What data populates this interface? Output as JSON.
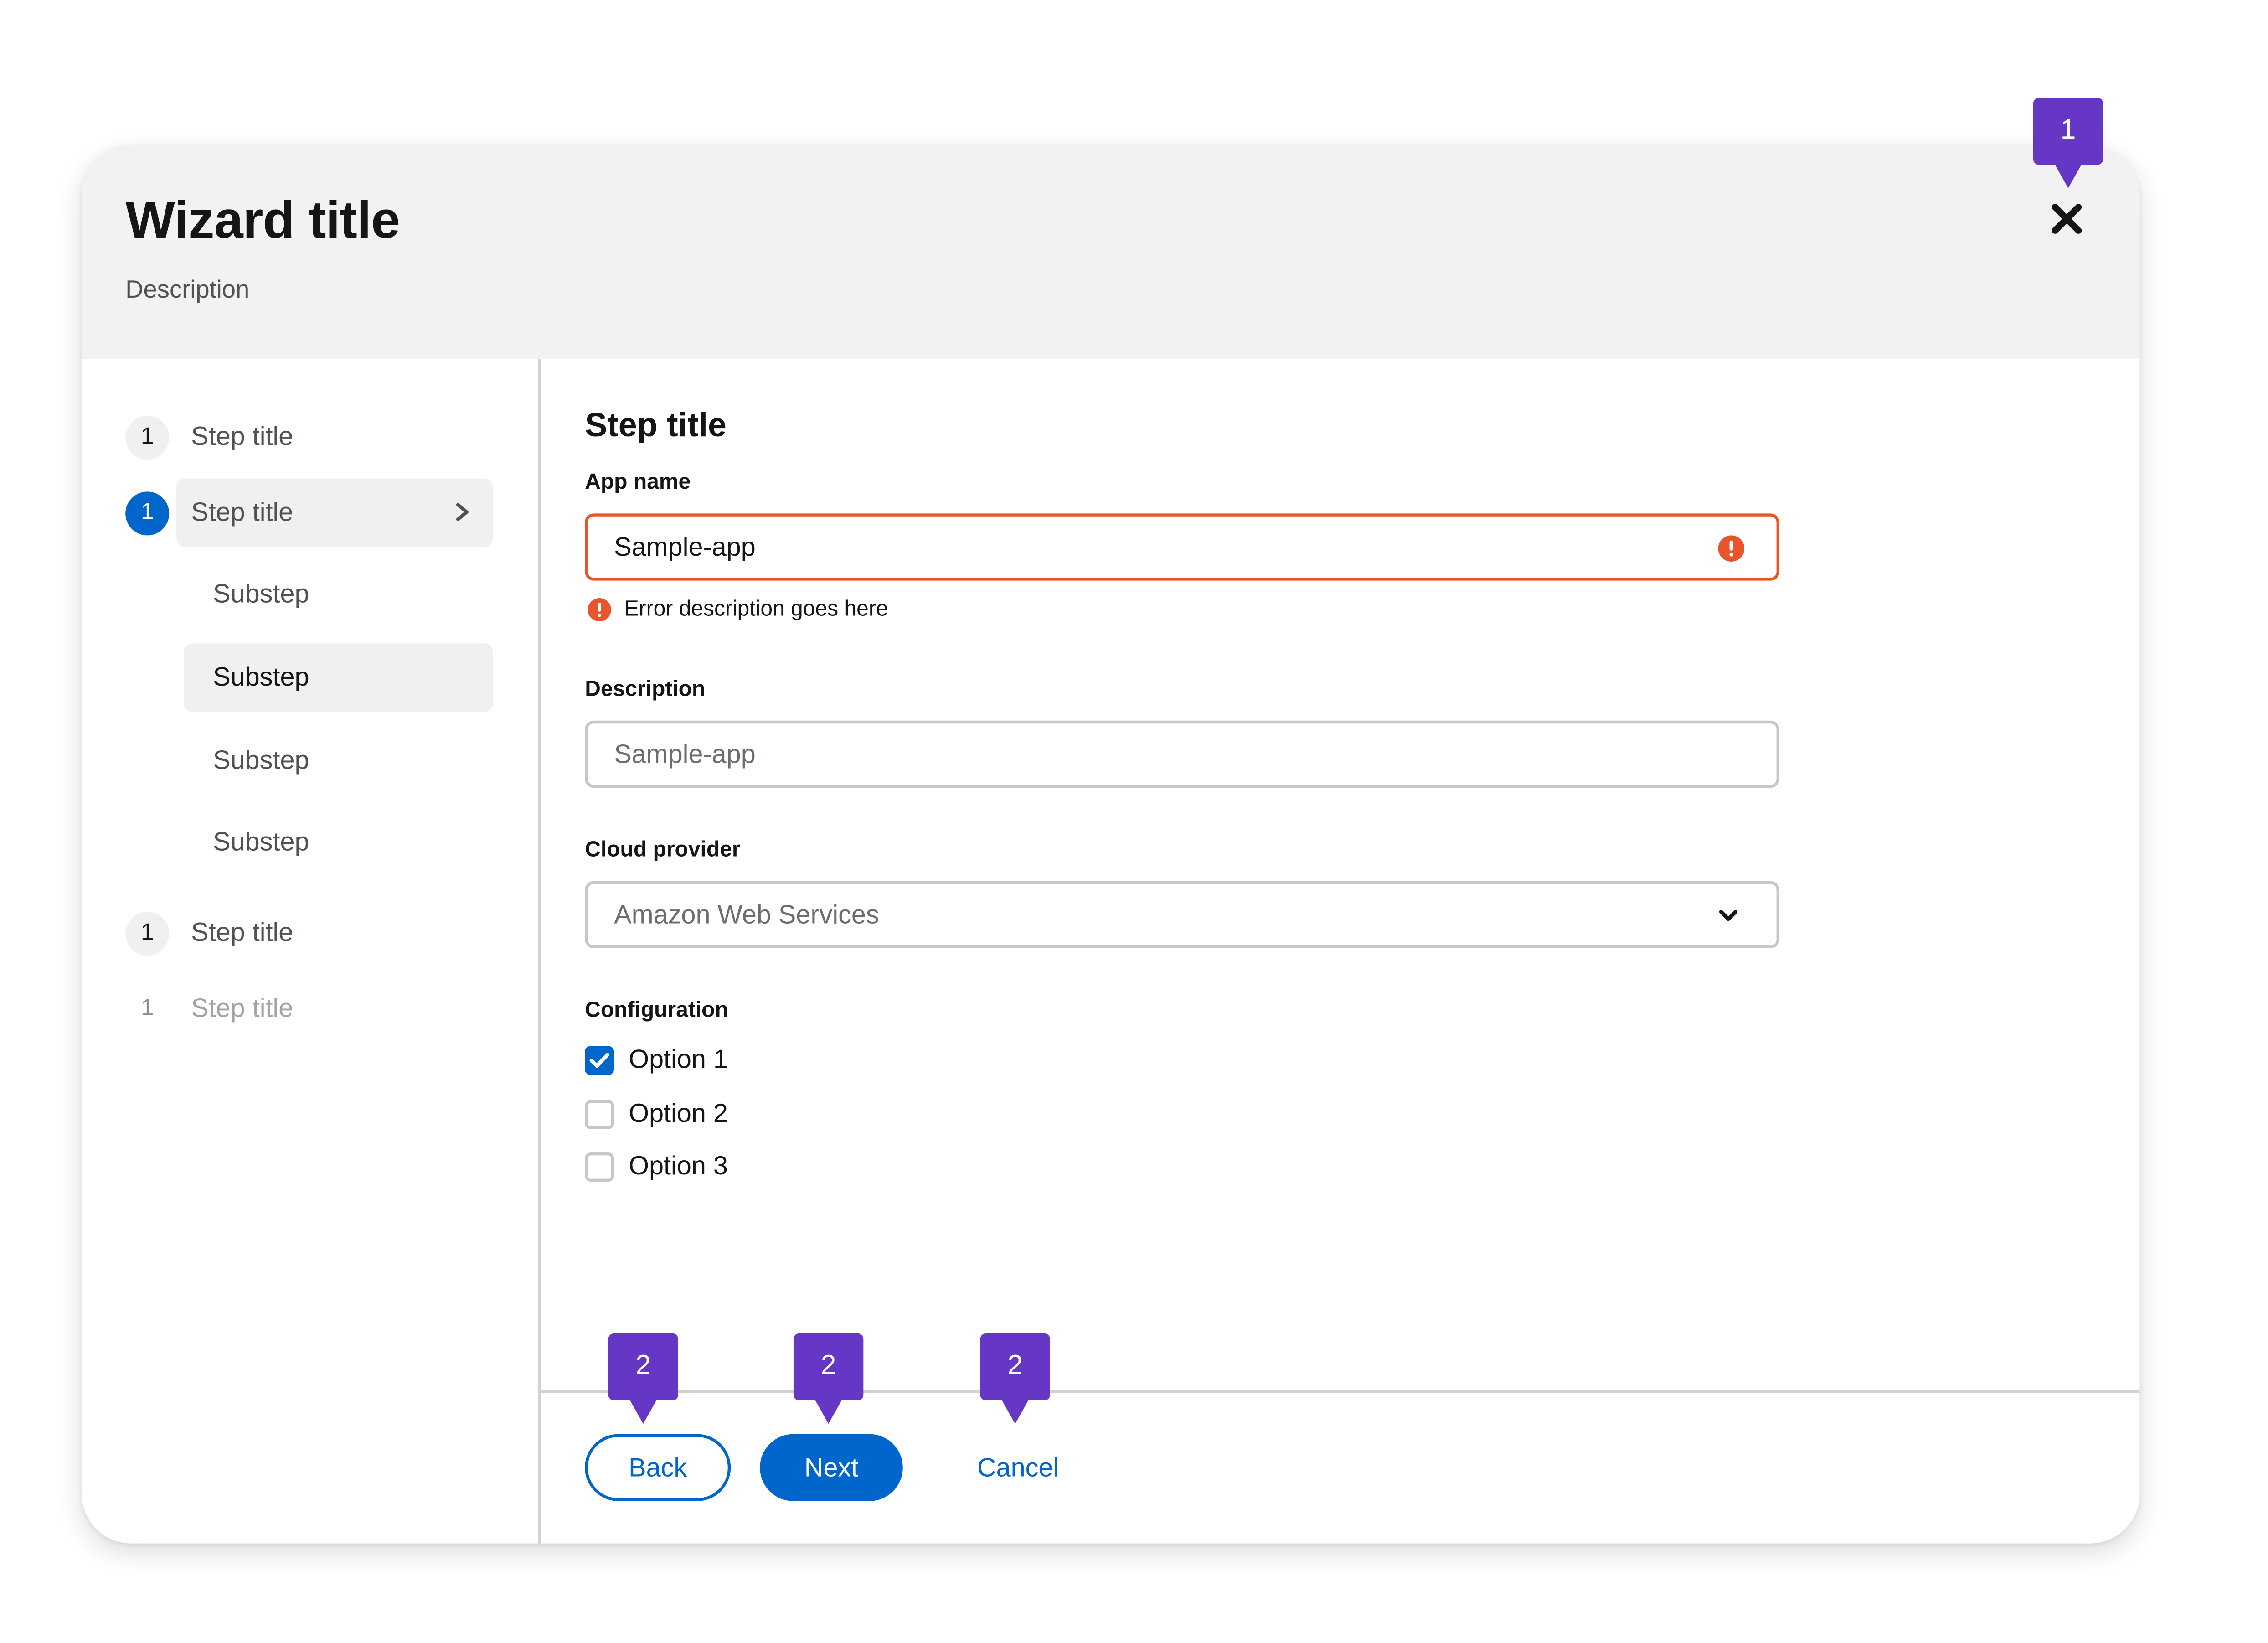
{
  "wizard": {
    "title": "Wizard title",
    "description": "Description"
  },
  "nav": {
    "steps": [
      {
        "number": "1",
        "label": "Step title",
        "state": "default"
      },
      {
        "number": "1",
        "label": "Step title",
        "state": "current"
      },
      {
        "number": "1",
        "label": "Step title",
        "state": "default"
      },
      {
        "number": "1",
        "label": "Step title",
        "state": "disabled"
      }
    ],
    "substeps": [
      {
        "label": "Substep",
        "active": false
      },
      {
        "label": "Substep",
        "active": true
      },
      {
        "label": "Substep",
        "active": false
      },
      {
        "label": "Substep",
        "active": false
      }
    ]
  },
  "main": {
    "step_title": "Step title",
    "app_name": {
      "label": "App name",
      "value": "Sample-app",
      "error": "Error description goes here"
    },
    "description": {
      "label": "Description",
      "placeholder": "Sample-app"
    },
    "cloud_provider": {
      "label": "Cloud provider",
      "selected": "Amazon Web Services"
    },
    "configuration": {
      "label": "Configuration",
      "options": [
        {
          "label": "Option 1",
          "checked": true
        },
        {
          "label": "Option 2",
          "checked": false
        },
        {
          "label": "Option 3",
          "checked": false
        }
      ]
    }
  },
  "footer": {
    "back": "Back",
    "next": "Next",
    "cancel": "Cancel"
  },
  "callouts": {
    "close": "1",
    "back": "2",
    "next": "2",
    "cancel": "2"
  },
  "colors": {
    "accent": "#0066cc",
    "error": "#e8552a",
    "callout": "#6537c4",
    "header_bg": "#f2f2f2"
  },
  "icons": [
    "close-icon",
    "chevron-right-icon",
    "exclamation-circle-icon",
    "chevron-down-icon",
    "checkmark-icon"
  ]
}
